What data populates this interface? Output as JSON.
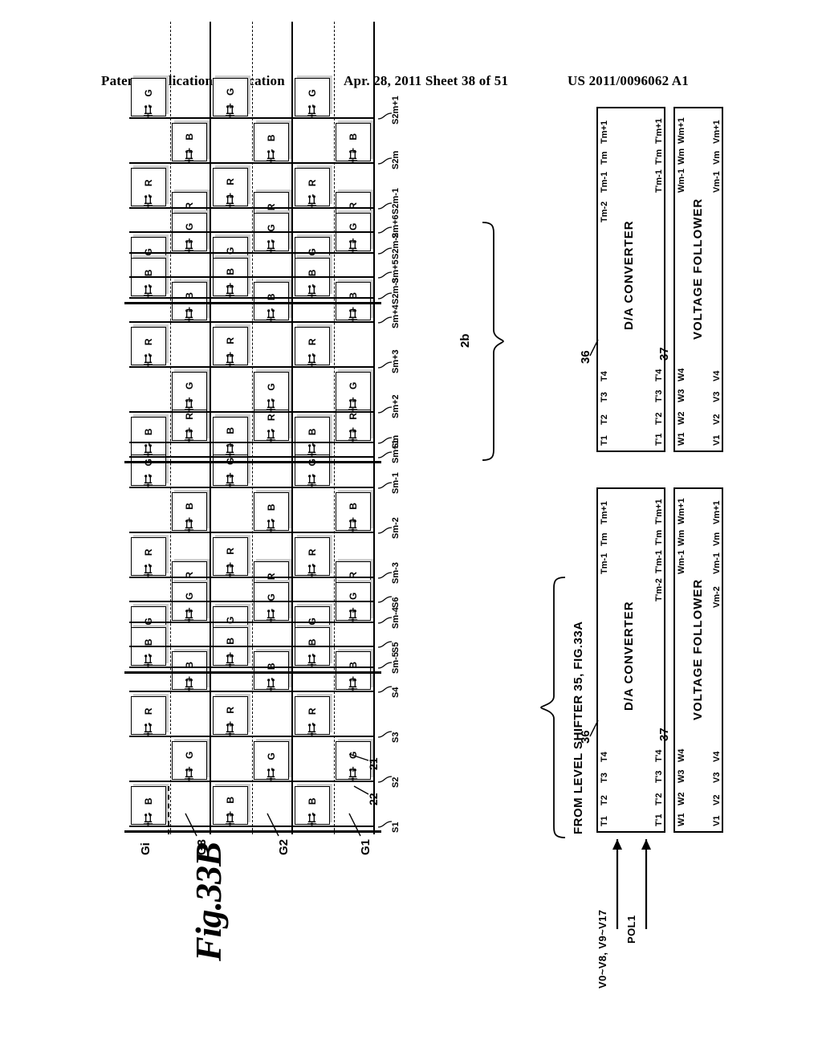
{
  "header": {
    "publication": "Patent Application Publication",
    "date_sheet": "Apr. 28, 2011  Sheet 38 of 51",
    "patent_number": "US 2011/0096062 A1"
  },
  "figure": {
    "title": "Fig.33B",
    "source_note": "FROM LEVEL SHIFTER 35, FIG.33A",
    "panel_ref": "2b",
    "input_labels": [
      "V0~V8, V9~V17",
      "POL1"
    ],
    "refs": {
      "dac": "36",
      "voltage_follower": "37",
      "pixel_electrode": "21",
      "tft": "22"
    },
    "blocks": {
      "dac_label": "D/A CONVERTER",
      "vf_label": "VOLTAGE FOLLOWER"
    }
  },
  "lower_bank": {
    "dac_in": [
      "T1",
      "T2",
      "T3",
      "T4",
      "Tm-1",
      "Tm",
      "Tm+1"
    ],
    "dac_out": [
      "T'1",
      "T'2",
      "T'3",
      "T'4",
      "T'm-2",
      "T'm-1",
      "T'm",
      "T'm+1"
    ],
    "vf_in": [
      "W1",
      "W2",
      "W3",
      "W4",
      "Wm-1",
      "Wm",
      "Wm+1"
    ],
    "vf_out": [
      "V1",
      "V2",
      "V3",
      "V4",
      "Vm-2",
      "Vm-1",
      "Vm",
      "Vm+1"
    ],
    "source_lines": [
      "S1",
      "S2",
      "S3",
      "S4",
      "S5",
      "S6",
      "Sm-5",
      "Sm-4",
      "Sm-3",
      "Sm-2",
      "Sm-1",
      "Sm"
    ]
  },
  "upper_bank": {
    "dac_in": [
      "T1",
      "T2",
      "T3",
      "T4",
      "Tm-2",
      "Tm-1",
      "Tm",
      "Tm+1"
    ],
    "dac_out": [
      "T'1",
      "T'2",
      "T'3",
      "T'4",
      "T'm-1",
      "T'm",
      "T'm+1"
    ],
    "vf_in": [
      "W1",
      "W2",
      "W3",
      "W4",
      "Wm-1",
      "Wm",
      "Wm+1"
    ],
    "vf_out": [
      "V1",
      "V2",
      "V3",
      "V4",
      "Vm-1",
      "Vm",
      "Vm+1"
    ],
    "source_lines": [
      "Sm+1",
      "Sm+2",
      "Sm+3",
      "Sm+4",
      "Sm+5",
      "Sm+6",
      "S2m-3",
      "S2m-2",
      "S2m-1",
      "S2m",
      "S2m+1"
    ]
  },
  "gate_lines": [
    "G1",
    "G2",
    "G3",
    "Gi"
  ],
  "pixel_matrix": {
    "column_groups": 3,
    "row_colors": [
      "R",
      "G",
      "B",
      "R",
      "G",
      "B"
    ],
    "note": "checkerboard dot-inversion: polarity alternates by row and by column group",
    "polarity_symbols": [
      "+",
      "-"
    ],
    "group_blocks": [
      {
        "name": "bank-b-block-3",
        "rows": [
          {
            "color": "B",
            "pols": [
              "-",
              "+",
              "-"
            ]
          },
          {
            "color": "G",
            "pols": [
              "+",
              "-",
              "+"
            ]
          },
          {
            "color": "R",
            "pols": [
              "-",
              "+",
              "-"
            ]
          },
          {
            "color": "B",
            "pols": [
              "+",
              "-",
              "+"
            ]
          },
          {
            "color": "G",
            "pols": [
              "-",
              "+",
              "-"
            ]
          },
          {
            "color": "R",
            "pols": [
              "+",
              "-",
              "+"
            ]
          }
        ]
      },
      {
        "name": "bank-b-block-2",
        "rows": [
          {
            "color": "B",
            "pols": [
              "-",
              "+",
              "-"
            ]
          },
          {
            "color": "G",
            "pols": [
              "+",
              "-",
              "+"
            ]
          },
          {
            "color": "R",
            "pols": [
              "-",
              "+",
              "-"
            ]
          },
          {
            "color": "B",
            "pols": [
              "+",
              "-",
              "+"
            ]
          },
          {
            "color": "G",
            "pols": [
              "-",
              "+",
              "-"
            ]
          },
          {
            "color": "R",
            "pols": [
              "+",
              "-",
              "+"
            ]
          }
        ]
      },
      {
        "name": "bank-a-block-2",
        "rows": [
          {
            "color": "B",
            "pols": [
              "-",
              "+",
              "-"
            ]
          },
          {
            "color": "G",
            "pols": [
              "+",
              "-",
              "+"
            ]
          },
          {
            "color": "R",
            "pols": [
              "-",
              "+",
              "-"
            ]
          },
          {
            "color": "B",
            "pols": [
              "+",
              "-",
              "+"
            ]
          },
          {
            "color": "G",
            "pols": [
              "-",
              "+",
              "-"
            ]
          },
          {
            "color": "R",
            "pols": [
              "+",
              "-",
              "+"
            ]
          }
        ]
      },
      {
        "name": "bank-a-block-1",
        "rows": [
          {
            "color": "B",
            "pols": [
              "-",
              "+",
              "-"
            ]
          },
          {
            "color": "G",
            "pols": [
              "+",
              "-",
              "+"
            ]
          },
          {
            "color": "R",
            "pols": [
              "-",
              "+",
              "-"
            ]
          },
          {
            "color": "B",
            "pols": [
              "+",
              "-",
              "+"
            ]
          },
          {
            "color": "G",
            "pols": [
              "-",
              "+",
              "-"
            ]
          },
          {
            "color": "R",
            "pols": [
              "+",
              "-",
              "+"
            ]
          }
        ]
      }
    ]
  }
}
